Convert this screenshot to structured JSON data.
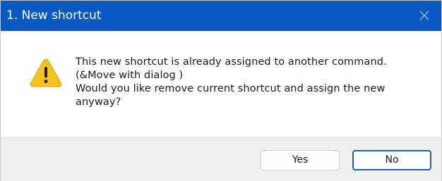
{
  "window": {
    "title": "1. New shortcut",
    "close_icon": "close-icon"
  },
  "message": {
    "icon": "warning-icon",
    "lines": [
      "This new shortcut is already assigned to another command.",
      "(&Move with dialog )",
      "Would you like remove current shortcut and assign the new",
      "anyway?"
    ]
  },
  "buttons": {
    "yes_label": "Yes",
    "no_label": "No"
  },
  "colors": {
    "titlebar": "#0a58c2",
    "focus_border": "#1b5fc9",
    "warning_fill": "#f8c21c"
  }
}
